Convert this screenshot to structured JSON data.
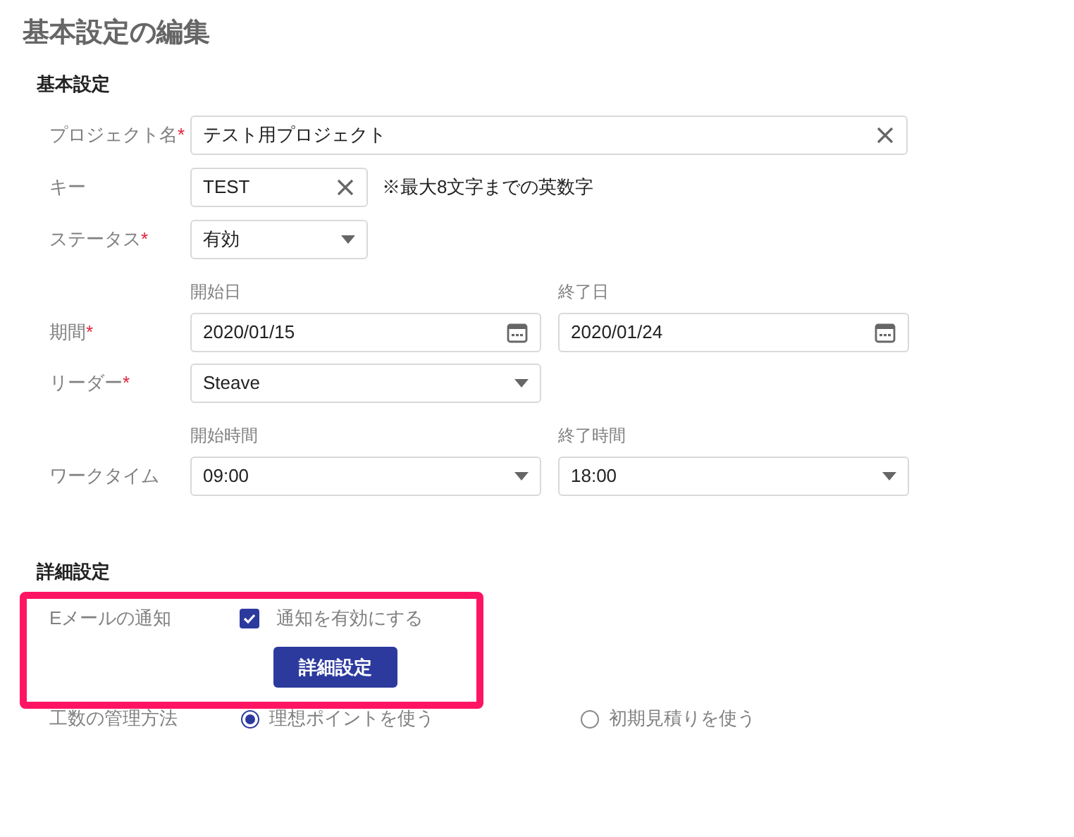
{
  "page_title": "基本設定の編集",
  "basic": {
    "heading": "基本設定",
    "fields": [
      {
        "kind": "text",
        "label": "プロジェクト名",
        "required_mark": "*",
        "value": "テスト用プロジェクト"
      },
      {
        "kind": "short_text",
        "label": "キー",
        "value": "TEST",
        "note": "※最大8文字までの英数字"
      },
      {
        "kind": "short_select",
        "label": "ステータス",
        "required_mark": "*",
        "value": "有効"
      },
      {
        "kind": "date_range",
        "label": "期間",
        "required_mark": "*",
        "start_label": "開始日",
        "start": "2020/01/15",
        "end_label": "終了日",
        "end": "2020/01/24"
      },
      {
        "kind": "select",
        "label": "リーダー",
        "required_mark": "*",
        "value": "Steave"
      },
      {
        "kind": "select_range",
        "label": "ワークタイム",
        "start_label": "開始時間",
        "start": "09:00",
        "end_label": "終了時間",
        "end": "18:00"
      }
    ]
  },
  "detail": {
    "heading": "詳細設定",
    "email": {
      "label": "Eメールの通知",
      "highlighted": true,
      "checkbox_label": "通知を有効にする",
      "checked": true,
      "button": "詳細設定"
    },
    "estimation": {
      "label": "工数の管理方法",
      "options": [
        {
          "label": "理想ポイントを使う",
          "selected": true
        },
        {
          "label": "初期見積りを使う",
          "selected": false
        }
      ]
    }
  }
}
